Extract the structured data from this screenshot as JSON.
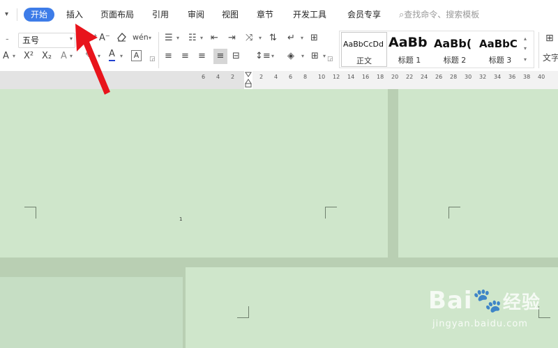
{
  "quick_menu_icon": "chevron-down-icon",
  "tabs": [
    {
      "label": "开始",
      "active": true
    },
    {
      "label": "插入"
    },
    {
      "label": "页面布局"
    },
    {
      "label": "引用"
    },
    {
      "label": "审阅"
    },
    {
      "label": "视图"
    },
    {
      "label": "章节"
    },
    {
      "label": "开发工具"
    },
    {
      "label": "会员专享"
    }
  ],
  "search": {
    "placeholder": "查找命令、搜索模板",
    "icon": "search-icon"
  },
  "font": {
    "size_value": "五号"
  },
  "format_buttons": {
    "increase_font": "A⁺",
    "decrease_font": "A⁻",
    "clear_format": "eraser-icon",
    "phonetic": "wén",
    "text_effect": "A",
    "superscript": "X²",
    "subscript": "X₂",
    "outline": "A",
    "font_color": "A",
    "char_border": "A"
  },
  "styles": [
    {
      "preview": "AaBbCcDd",
      "name": "正文",
      "selected": true
    },
    {
      "preview": "AaBb",
      "name": "标题 1"
    },
    {
      "preview": "AaBb(",
      "name": "标题 2"
    },
    {
      "preview": "AaBbC",
      "name": "标题 3"
    }
  ],
  "text_tool_label": "文字",
  "ruler_ticks": [
    "6",
    "4",
    "2",
    "2",
    "4",
    "6",
    "8",
    "10",
    "12",
    "14",
    "16",
    "18",
    "20",
    "22",
    "24",
    "26",
    "28",
    "30",
    "32",
    "34",
    "36",
    "38",
    "40"
  ],
  "page_number": "1",
  "watermark": {
    "brand": "Bai",
    "brand2": "经验",
    "url": "jingyan.baidu.com"
  },
  "colors": {
    "accent": "#3d7ce8",
    "page": "#cfe6cb",
    "canvas": "#b9cfb3",
    "arrow": "#e8141c"
  }
}
